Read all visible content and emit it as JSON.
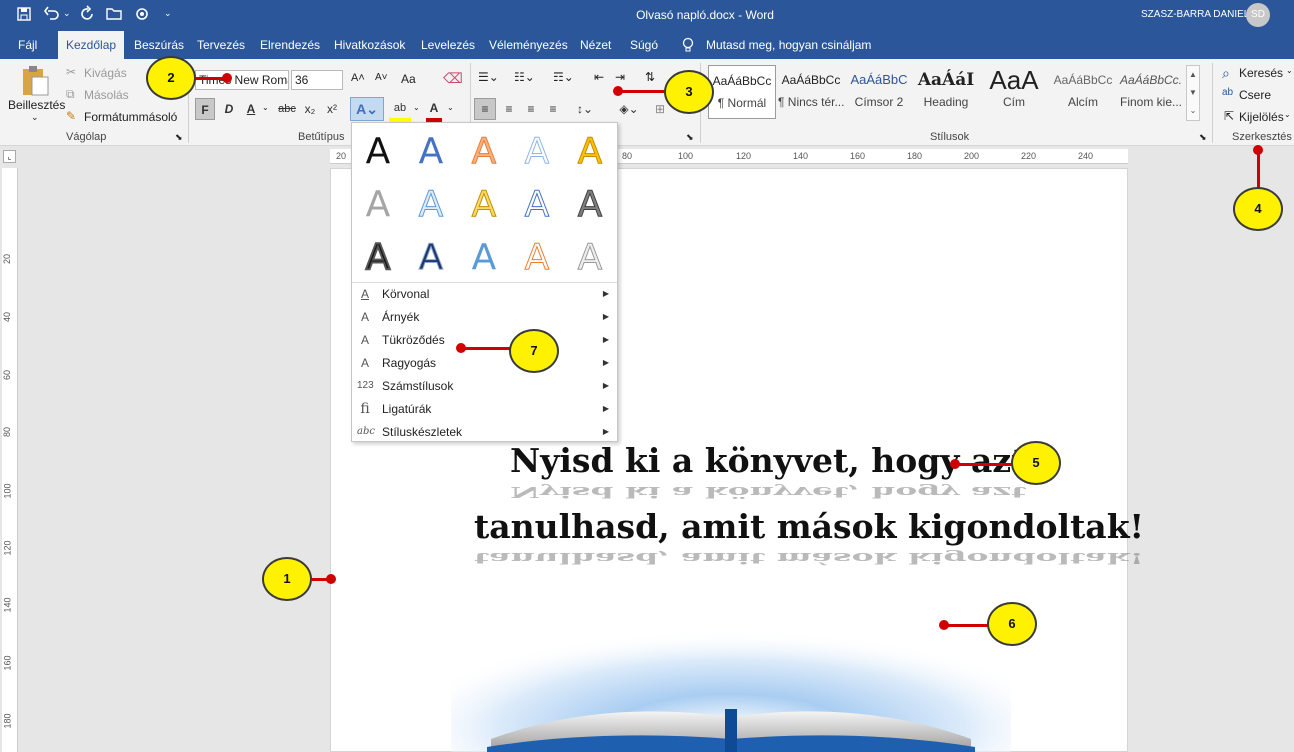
{
  "titlebar": {
    "title": "Olvasó napló.docx  -  Word",
    "user": "SZASZ-BARRA DANIEL",
    "initials": "SD",
    "qat_more": "⌄"
  },
  "tabs": [
    "Fájl",
    "Kezdőlap",
    "Beszúrás",
    "Tervezés",
    "Elrendezés",
    "Hivatkozások",
    "Levelezés",
    "Véleményezés",
    "Nézet",
    "Súgó"
  ],
  "tellme": "Mutasd meg, hogyan csináljam",
  "clipboard": {
    "paste": "Beillesztés",
    "cut": "Kivágás",
    "copy": "Másolás",
    "format_painter": "Formátummásoló",
    "group": "Vágólap"
  },
  "font": {
    "name": "Times New Roman",
    "size": "36",
    "group": "Betűtípus",
    "bold": "F",
    "italic": "D",
    "underline": "A",
    "strike": "abc",
    "sub": "x₂",
    "sup": "x²",
    "grow": "A˄",
    "shrink": "A˅",
    "case": "Aa"
  },
  "styles": {
    "group": "Stílusok",
    "items": [
      {
        "preview": "AaÁáBbCc",
        "label": "¶ Normál"
      },
      {
        "preview": "AaÁáBbCc",
        "label": "¶ Nincs tér..."
      },
      {
        "preview": "AaÁáBbC",
        "label": "Címsor 2"
      },
      {
        "preview": "AaÁáI",
        "label": "Heading"
      },
      {
        "preview": "AaA",
        "label": "Cím"
      },
      {
        "preview": "AaÁáBbCc",
        "label": "Alcím"
      },
      {
        "preview": "AaÁáBbCc.",
        "label": "Finom kie..."
      }
    ]
  },
  "editing": {
    "find": "Keresés",
    "replace": "Csere",
    "select": "Kijelölés",
    "group": "Szerkesztés"
  },
  "ruler": {
    "h_marks": [
      "20",
      "80",
      "100",
      "120",
      "140",
      "160",
      "180",
      "200",
      "220",
      "240"
    ],
    "v_marks": [
      "20",
      "40",
      "60",
      "80",
      "100",
      "120",
      "140",
      "160",
      "180"
    ]
  },
  "doc": {
    "line1": "Nyisd ki a könyvet, hogy azt",
    "line2": "tanulhasd, amit mások kigondoltak!"
  },
  "effects_menu": {
    "items": [
      {
        "icon": "A",
        "label": "Körvonal"
      },
      {
        "icon": "A",
        "label": "Árnyék"
      },
      {
        "icon": "A",
        "label": "Tükröződés"
      },
      {
        "icon": "A",
        "label": "Ragyogás"
      },
      {
        "icon": "123",
        "label": "Számstílusok"
      },
      {
        "icon": "fi",
        "label": "Ligatúrák"
      },
      {
        "icon": "abc",
        "label": "Stíluskészletek"
      }
    ],
    "arrow": "▶"
  },
  "glyph": "A",
  "callouts": [
    "1",
    "2",
    "3",
    "4",
    "5",
    "6",
    "7"
  ],
  "colors": {
    "brand": "#2b579a",
    "callout": "#fff200",
    "callout_line": "#d00000"
  }
}
